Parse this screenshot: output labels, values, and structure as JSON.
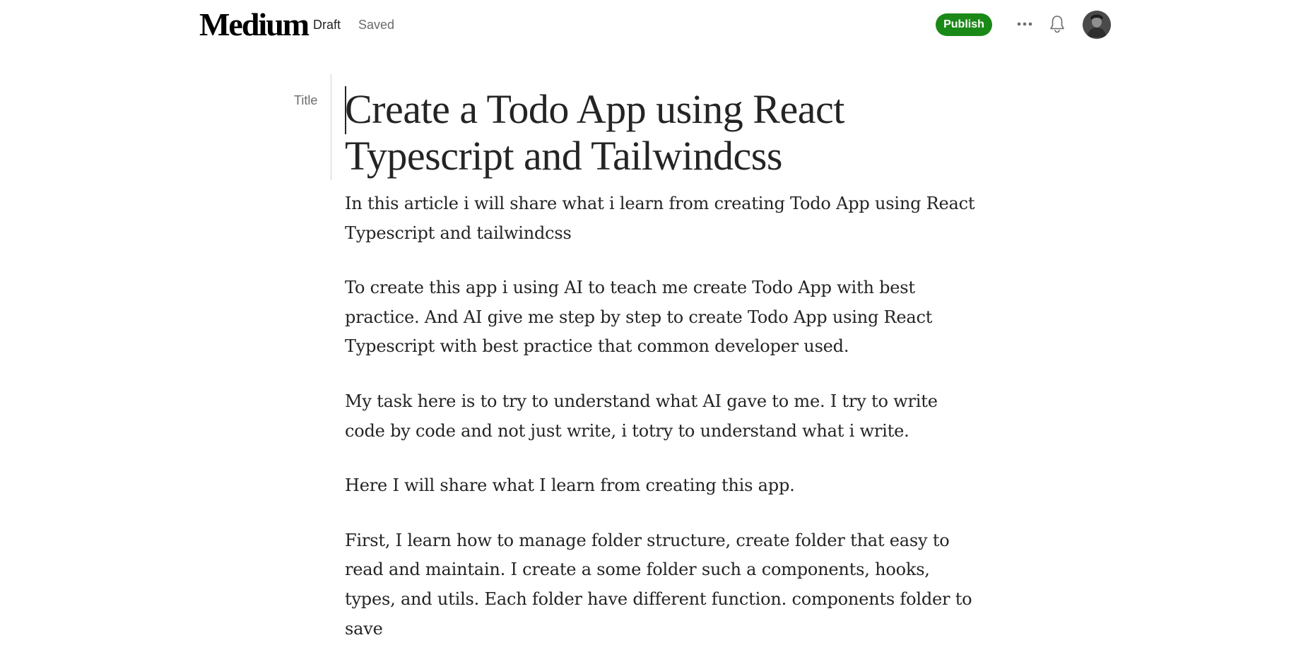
{
  "header": {
    "logo": "Medium",
    "draft_label": "Draft",
    "save_status": "Saved",
    "publish_label": "Publish",
    "more_icon": "more-horizontal-icon",
    "notification_icon": "bell-icon",
    "avatar_icon": "user-avatar",
    "brand_color": "#1a8917"
  },
  "editor": {
    "title_label": "Title",
    "title": "Create a Todo App using React Typescript and Tailwindcss",
    "paragraphs": [
      "In this article i will share what i learn from creating Todo App using React Typescript and tailwindcss",
      "To create this app i using AI to teach me create Todo App with best practice. And AI give me step by step to create Todo App using React Typescript with best practice that common developer used.",
      "My task here is to try to understand what AI gave to me. I try to write code by code and not just write, i totry to understand what i write.",
      "Here I will share what I learn from creating this app.",
      "First, I learn how to manage folder structure, create folder that easy to read and maintain. I create a some folder such a components, hooks, types, and utils. Each folder have different function. components folder to save"
    ]
  }
}
